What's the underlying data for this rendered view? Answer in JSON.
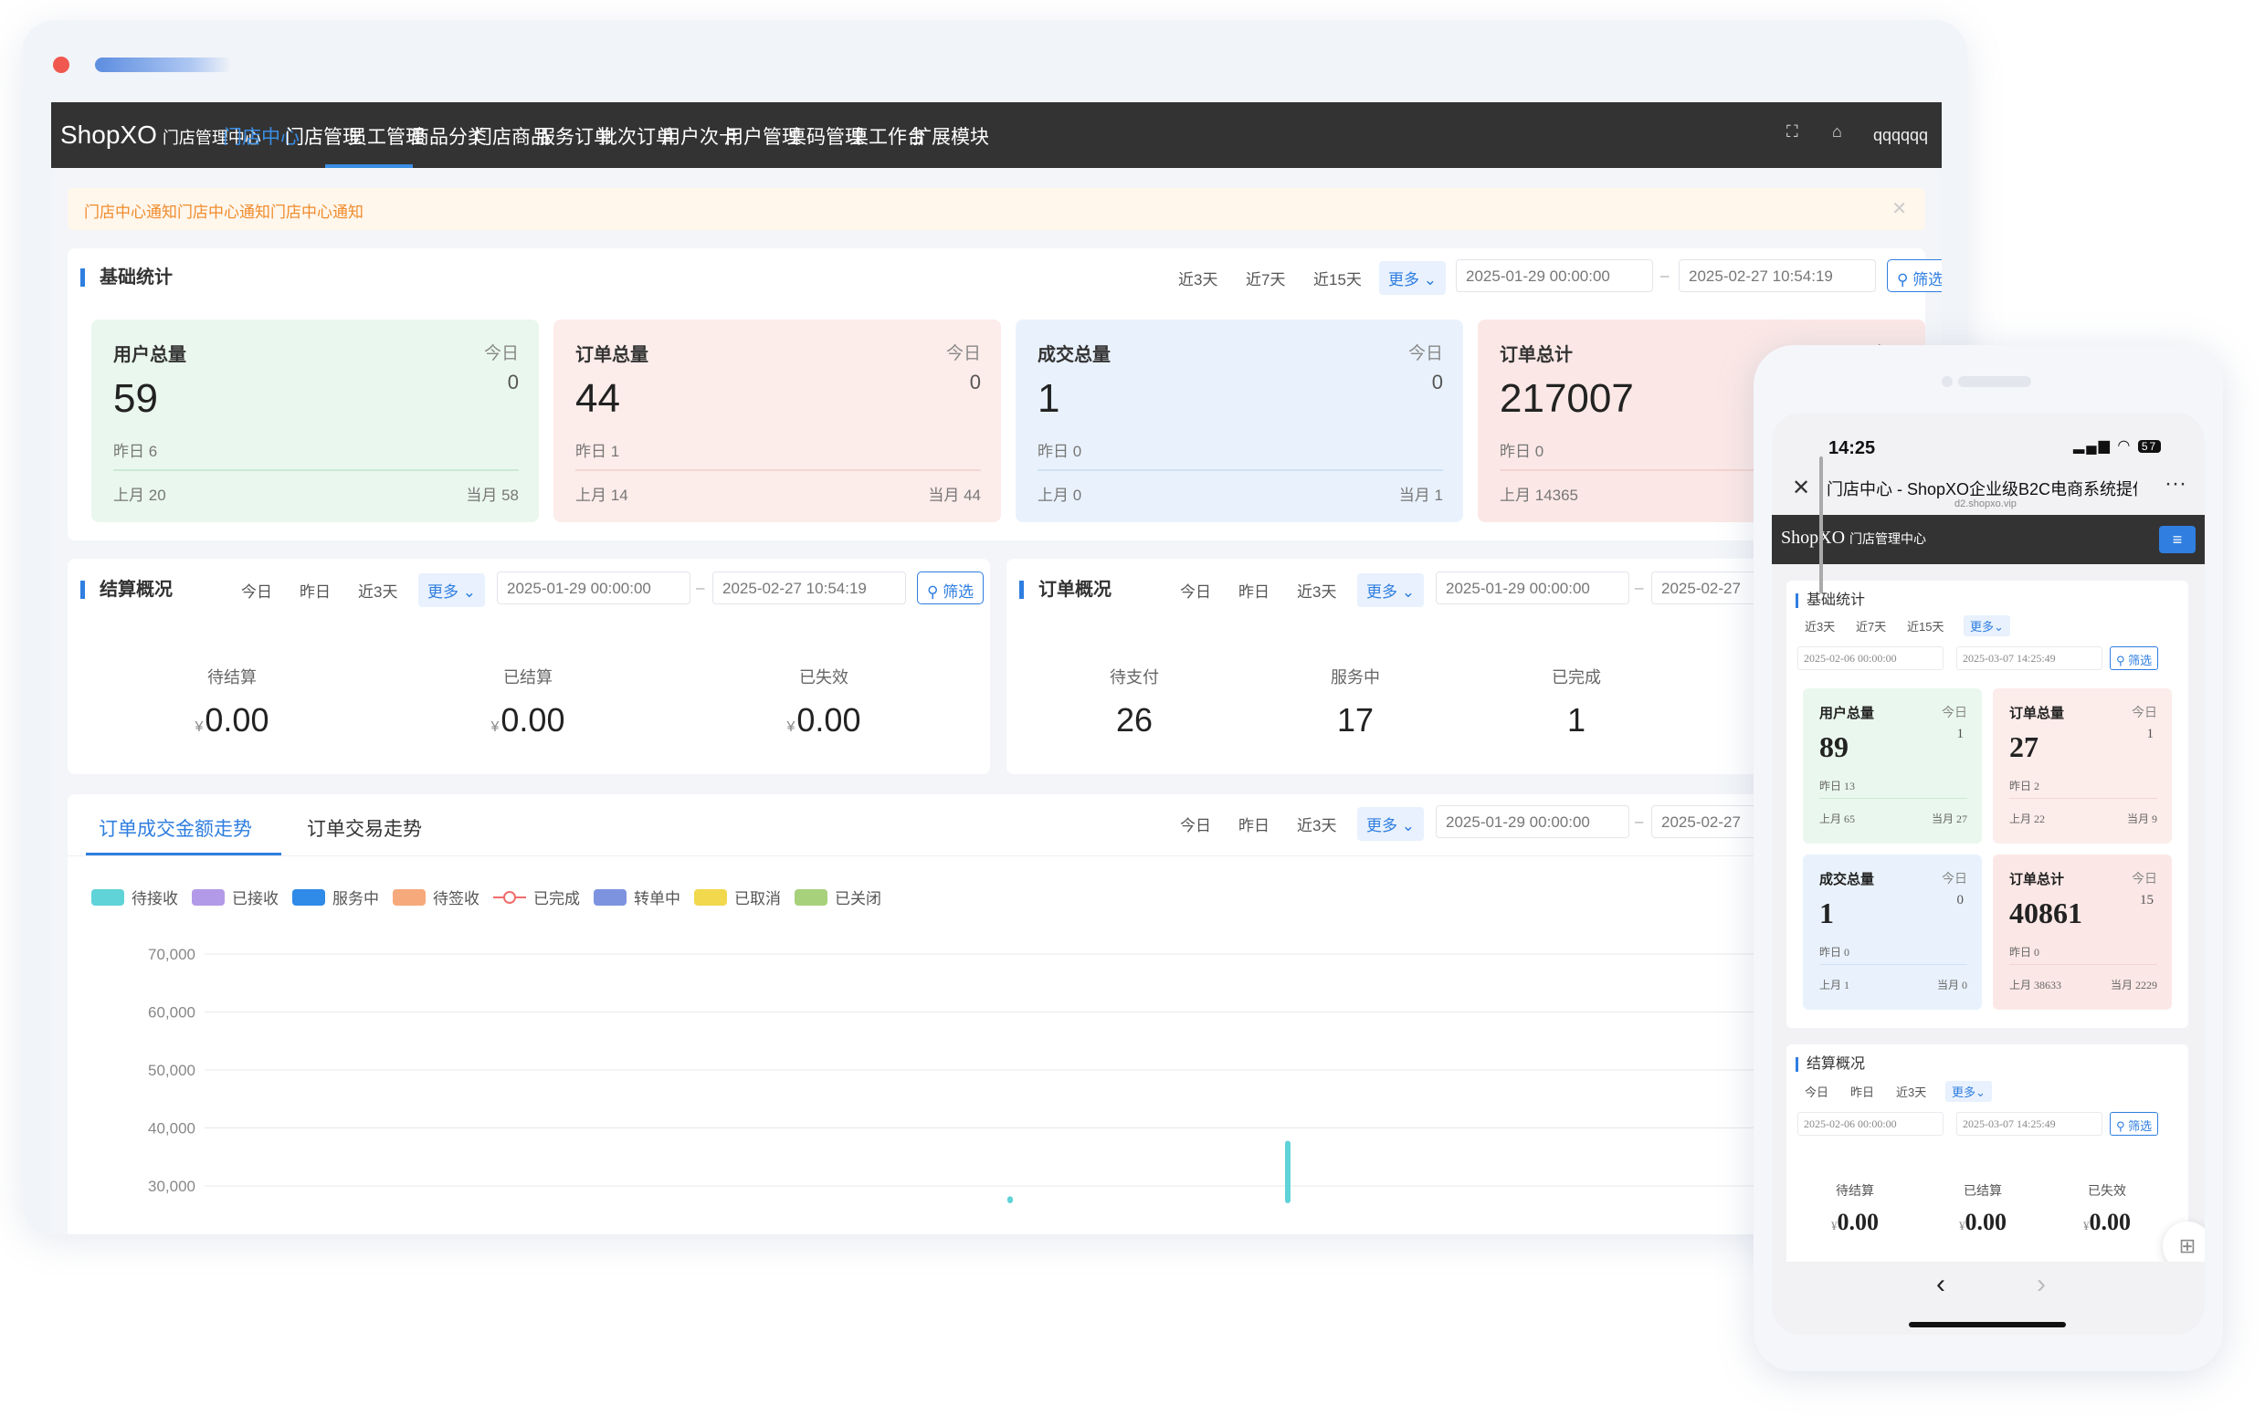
{
  "desktop": {
    "brand": "ShopXO",
    "brand_sub": "门店管理中心",
    "nav": [
      "门店中心",
      "门店管理",
      "员工管理",
      "商品分类",
      "门店商品",
      "服务订单",
      "批次订单",
      "用户次卡",
      "用户管理",
      "桌码管理",
      "桌工作台",
      "扩展模块"
    ],
    "nav_active": "门店中心",
    "username": "qqqqqq",
    "notice": "门店中心通知门店中心通知门店中心通知",
    "basic": {
      "title": "基础统计",
      "ranges": [
        "近3天",
        "近7天",
        "近15天"
      ],
      "more": "更多",
      "start": "2025-01-29 00:00:00",
      "end": "2025-02-27 10:54:19",
      "filter": "筛选",
      "cards": [
        {
          "label": "用户总量",
          "today_label": "今日",
          "today": "0",
          "total": "59",
          "yesterday_label": "昨日",
          "yesterday": "6",
          "last_month_label": "上月",
          "last_month": "20",
          "this_month_label": "当月",
          "this_month": "58",
          "bg": "#eaf7ee",
          "line": "#cbe9d4"
        },
        {
          "label": "订单总量",
          "today_label": "今日",
          "today": "0",
          "total": "44",
          "yesterday_label": "昨日",
          "yesterday": "1",
          "last_month_label": "上月",
          "last_month": "14",
          "this_month_label": "当月",
          "this_month": "44",
          "bg": "#fcecea",
          "line": "#f3d6d3"
        },
        {
          "label": "成交总量",
          "today_label": "今日",
          "today": "0",
          "total": "1",
          "yesterday_label": "昨日",
          "yesterday": "0",
          "last_month_label": "上月",
          "last_month": "0",
          "this_month_label": "当月",
          "this_month": "1",
          "bg": "#e9f2fc",
          "line": "#d0e1f5"
        },
        {
          "label": "订单总计",
          "today_label": "今日",
          "today": "",
          "total": "217007",
          "yesterday_label": "昨日",
          "yesterday": "0",
          "last_month_label": "上月",
          "last_month": "14365",
          "this_month_label": "",
          "this_month": "",
          "bg": "#fbe8e6",
          "line": "#f3d3d0"
        }
      ]
    },
    "settle": {
      "title": "结算概况",
      "ranges": [
        "今日",
        "昨日",
        "近3天"
      ],
      "more": "更多",
      "start": "2025-01-29 00:00:00",
      "end": "2025-02-27 10:54:19",
      "filter": "筛选",
      "items": [
        {
          "k": "待结算",
          "cur": "¥",
          "v": "0.00"
        },
        {
          "k": "已结算",
          "cur": "¥",
          "v": "0.00"
        },
        {
          "k": "已失效",
          "cur": "¥",
          "v": "0.00"
        }
      ]
    },
    "orders": {
      "title": "订单概况",
      "ranges": [
        "今日",
        "昨日",
        "近3天"
      ],
      "more": "更多",
      "start": "2025-01-29 00:00:00",
      "end": "2025-02-27",
      "items": [
        {
          "k": "待支付",
          "v": "26"
        },
        {
          "k": "服务中",
          "v": "17"
        },
        {
          "k": "已完成",
          "v": "1"
        }
      ]
    },
    "trend": {
      "tabs": [
        "订单成交金额走势",
        "订单交易走势"
      ],
      "ranges": [
        "今日",
        "昨日",
        "近3天"
      ],
      "more": "更多",
      "start": "2025-01-29 00:00:00",
      "end": "2025-02-27"
    }
  },
  "chart_data": {
    "type": "bar",
    "series": [
      {
        "name": "待接收",
        "color": "#5fd3d8"
      },
      {
        "name": "已接收",
        "color": "#b39ae8"
      },
      {
        "name": "服务中",
        "color": "#2f8ae8"
      },
      {
        "name": "待签收",
        "color": "#f6a97a"
      },
      {
        "name": "已完成",
        "color": "#f06c6c"
      },
      {
        "name": "转单中",
        "color": "#7d93e0"
      },
      {
        "name": "已取消",
        "color": "#f1d84d"
      },
      {
        "name": "已关闭",
        "color": "#a8d17c"
      }
    ],
    "yticks": [
      "70,000",
      "60,000",
      "50,000",
      "40,000",
      "30,000"
    ],
    "bars": [
      {
        "series": "待接收",
        "value": 28200
      },
      {
        "series": "待接收",
        "value": 37800
      }
    ]
  },
  "mobile": {
    "time": "14:25",
    "battery": "57",
    "title": "门店中心 - ShopXO企业级B2C电商系统提供商",
    "url": "d2.shopxo.vip",
    "brand": "ShopXO",
    "brand_sub": "门店管理中心",
    "basic": {
      "title": "基础统计",
      "ranges": [
        "近3天",
        "近7天",
        "近15天"
      ],
      "more": "更多",
      "start": "2025-02-06 00:00:00",
      "end": "2025-03-07 14:25:49",
      "filter": "筛选",
      "cards": [
        {
          "label": "用户总量",
          "today_label": "今日",
          "today": "1",
          "total": "89",
          "yesterday_label": "昨日",
          "yesterday": "13",
          "last_month_label": "上月",
          "last_month": "65",
          "this_month_label": "当月",
          "this_month": "27",
          "bg": "#eaf7ee",
          "line": "#cbe9d4"
        },
        {
          "label": "订单总量",
          "today_label": "今日",
          "today": "1",
          "total": "27",
          "yesterday_label": "昨日",
          "yesterday": "2",
          "last_month_label": "上月",
          "last_month": "22",
          "this_month_label": "当月",
          "this_month": "9",
          "bg": "#fcecea",
          "line": "#f3d6d3"
        },
        {
          "label": "成交总量",
          "today_label": "今日",
          "today": "0",
          "total": "1",
          "yesterday_label": "昨日",
          "yesterday": "0",
          "last_month_label": "上月",
          "last_month": "1",
          "this_month_label": "当月",
          "this_month": "0",
          "bg": "#e9f2fc",
          "line": "#d0e1f5"
        },
        {
          "label": "订单总计",
          "today_label": "今日",
          "today": "15",
          "total": "40861",
          "yesterday_label": "昨日",
          "yesterday": "0",
          "last_month_label": "上月",
          "last_month": "38633",
          "this_month_label": "当月",
          "this_month": "2229",
          "bg": "#fbe8e6",
          "line": "#f3d3d0"
        }
      ]
    },
    "settle": {
      "title": "结算概况",
      "ranges": [
        "今日",
        "昨日",
        "近3天"
      ],
      "more": "更多",
      "start": "2025-02-06 00:00:00",
      "end": "2025-03-07 14:25:49",
      "filter": "筛选",
      "items": [
        {
          "k": "待结算",
          "cur": "¥",
          "v": "0.00"
        },
        {
          "k": "已结算",
          "cur": "¥",
          "v": "0.00"
        },
        {
          "k": "已失效",
          "cur": "¥",
          "v": "0.00"
        }
      ]
    }
  }
}
